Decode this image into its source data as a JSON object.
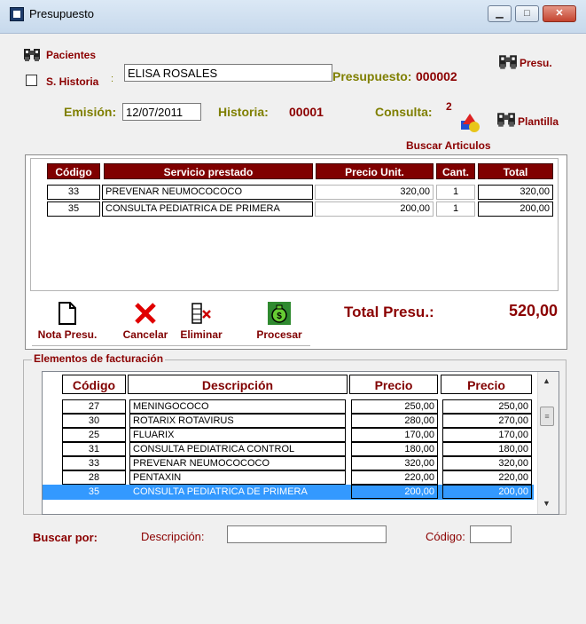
{
  "window": {
    "title": "Presupuesto"
  },
  "header": {
    "pacientes_label": "Pacientes",
    "s_historia_label": "S. Historia",
    "colon_mark": ":",
    "patient_name": "ELISA ROSALES",
    "presupuesto_label": "Presupuesto:",
    "presupuesto_value": "000002",
    "presu_button": "Presu.",
    "emision_label": "Emisión:",
    "emision_value": "12/07/2011",
    "historia_label": "Historia:",
    "historia_value": "00001",
    "consulta_label": "Consulta:",
    "consulta_value": "2",
    "plantilla_button": "Plantilla",
    "buscar_articulos": "Buscar Articulos"
  },
  "services": {
    "columns": [
      "Código",
      "Servicio prestado",
      "Precio Unit.",
      "Cant.",
      "Total"
    ],
    "rows": [
      {
        "codigo": "33",
        "servicio": "PREVENAR NEUMOCOCOCO",
        "precio": "320,00",
        "cant": "1",
        "total": "320,00"
      },
      {
        "codigo": "35",
        "servicio": "CONSULTA PEDIATRICA DE PRIMERA",
        "precio": "200,00",
        "cant": "1",
        "total": "200,00"
      }
    ]
  },
  "toolbar": {
    "nota": "Nota Presu.",
    "cancelar": "Cancelar",
    "eliminar": "Eliminar",
    "procesar": "Procesar"
  },
  "totals": {
    "label": "Total Presu.:",
    "value": "520,00"
  },
  "billing": {
    "group_title": "Elementos de facturación",
    "columns": [
      "Código",
      "Descripción",
      "Precio",
      "Precio"
    ],
    "rows": [
      {
        "codigo": "27",
        "descripcion": "MENINGOCOCO",
        "precio1": "250,00",
        "precio2": "250,00"
      },
      {
        "codigo": "30",
        "descripcion": "ROTARIX ROTAVIRUS",
        "precio1": "280,00",
        "precio2": "270,00"
      },
      {
        "codigo": "25",
        "descripcion": "FLUARIX",
        "precio1": "170,00",
        "precio2": "170,00"
      },
      {
        "codigo": "31",
        "descripcion": "CONSULTA PEDIATRICA CONTROL",
        "precio1": "180,00",
        "precio2": "180,00"
      },
      {
        "codigo": "33",
        "descripcion": "PREVENAR NEUMOCOCOCO",
        "precio1": "320,00",
        "precio2": "320,00"
      },
      {
        "codigo": "28",
        "descripcion": "PENTAXIN",
        "precio1": "220,00",
        "precio2": "220,00"
      },
      {
        "codigo": "35",
        "descripcion": "CONSULTA PEDIATRICA DE PRIMERA",
        "precio1": "200,00",
        "precio2": "200,00"
      }
    ],
    "selected_index": 6
  },
  "search": {
    "buscar_por": "Buscar por:",
    "descripcion_label": "Descripción:",
    "descripcion_value": "",
    "codigo_label": "Código:",
    "codigo_value": ""
  }
}
